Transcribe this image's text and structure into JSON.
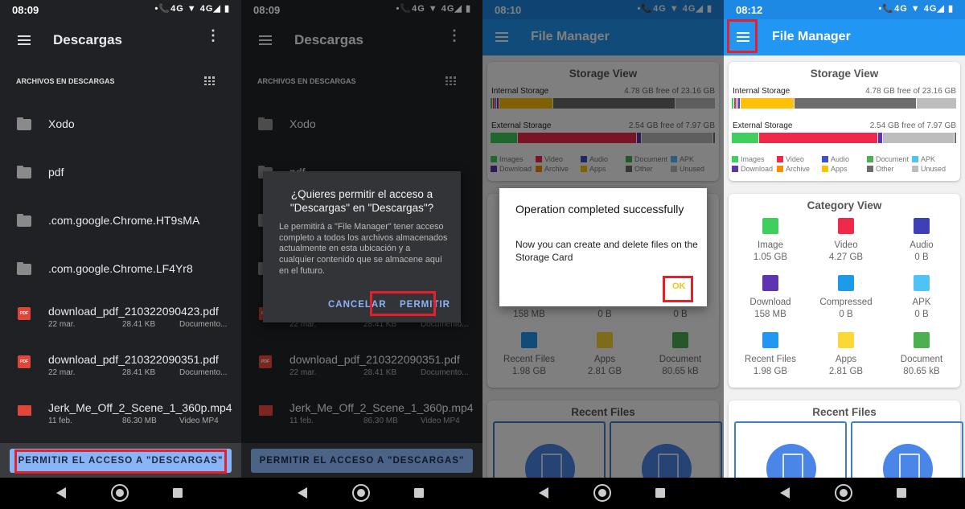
{
  "colors": {
    "highlight": "#e5202b",
    "fm_primary": "#2196f3",
    "dark_bg": "#202124",
    "accent_blue": "#8ab4f8"
  },
  "status_icons": "•📞4G ▼ 4G◢ ▮",
  "panel1": {
    "time": "08:09",
    "title": "Descargas",
    "section": "ARCHIVOS EN DESCARGAS",
    "folders": [
      "Xodo",
      "pdf",
      ".com.google.Chrome.HT9sMA",
      ".com.google.Chrome.LF4Yr8"
    ],
    "files": [
      {
        "icon": "pdf-icon",
        "name": "download_pdf_210322090423.pdf",
        "date": "22 mar.",
        "size": "28.41 KB",
        "type": "Documento..."
      },
      {
        "icon": "pdf-icon",
        "name": "download_pdf_210322090351.pdf",
        "date": "22 mar.",
        "size": "28.41 KB",
        "type": "Documento..."
      },
      {
        "icon": "video-icon",
        "name": "Jerk_Me_Off_2_Scene_1_360p.mp4",
        "date": "11 feb.",
        "size": "86.30 MB",
        "type": "Video MP4"
      }
    ],
    "allow_button": "PERMITIR EL ACCESO A \"DESCARGAS\""
  },
  "panel2": {
    "time": "08:09",
    "dialog": {
      "title": "¿Quieres permitir el acceso a \"Descargas\" en \"Descargas\"?",
      "message": "Le permitirá a \"File Manager\" tener acceso completo a todos los archivos almacenados actualmente en esta ubicación y a cualquier contenido que se almacene aquí en el futuro.",
      "cancel": "CANCELAR",
      "allow": "PERMITIR"
    }
  },
  "panel3": {
    "time": "08:10",
    "dialog": {
      "title": "Operation completed successfully",
      "message": "Now you can create and delete files on the Storage Card",
      "ok": "OK"
    }
  },
  "panel4": {
    "time": "08:12"
  },
  "file_manager": {
    "title": "File Manager",
    "storage": {
      "title": "Storage View",
      "internal": {
        "label": "Internal Storage",
        "value": "4.78 GB free of 23.16 GB",
        "segments_percent": [
          {
            "cat": "Images",
            "pct": 1
          },
          {
            "cat": "Video",
            "pct": 1
          },
          {
            "cat": "Audio",
            "pct": 1
          },
          {
            "cat": "Download",
            "pct": 1
          },
          {
            "cat": "Apps",
            "pct": 24
          },
          {
            "cat": "Other",
            "pct": 54
          },
          {
            "cat": "Unused",
            "pct": 18
          }
        ]
      },
      "external": {
        "label": "External Storage",
        "value": "2.54 GB free of 7.97 GB",
        "segments_percent": [
          {
            "cat": "Images",
            "pct": 12
          },
          {
            "cat": "Video",
            "pct": 53
          },
          {
            "cat": "Download",
            "pct": 2
          },
          {
            "cat": "Unused",
            "pct": 32
          },
          {
            "cat": "Other",
            "pct": 1
          }
        ]
      },
      "legend": [
        {
          "label": "Images",
          "color": "#3ecf5c"
        },
        {
          "label": "Video",
          "color": "#f0284a"
        },
        {
          "label": "Audio",
          "color": "#3f51c8"
        },
        {
          "label": "Document",
          "color": "#4caf50"
        },
        {
          "label": "APK",
          "color": "#4fc3f7"
        },
        {
          "label": "Download",
          "color": "#5e35b1"
        },
        {
          "label": "Archive",
          "color": "#fb8c00"
        },
        {
          "label": "Apps",
          "color": "#ffc107"
        },
        {
          "label": "Other",
          "color": "#6d6d6d"
        },
        {
          "label": "Unused",
          "color": "#bdbdbd"
        }
      ]
    },
    "categories": {
      "title": "Category View",
      "items": [
        {
          "name": "Image",
          "size": "1.05 GB",
          "icon": "image-icon",
          "color": "#3ecf5c"
        },
        {
          "name": "Video",
          "size": "4.27 GB",
          "icon": "video-camera-icon",
          "color": "#f0284a"
        },
        {
          "name": "Audio",
          "size": "0 B",
          "icon": "music-note-icon",
          "color": "#3f3fb8"
        },
        {
          "name": "Download",
          "size": "158 MB",
          "icon": "download-icon",
          "color": "#5e35b1"
        },
        {
          "name": "Compressed",
          "size": "0 B",
          "icon": "zip-icon",
          "color": "#1e9be8"
        },
        {
          "name": "APK",
          "size": "0 B",
          "icon": "android-icon",
          "color": "#4fc3f7"
        },
        {
          "name": "Recent Files",
          "size": "1.98 GB",
          "icon": "history-icon",
          "color": "#2196f3"
        },
        {
          "name": "Apps",
          "size": "2.81 GB",
          "icon": "apps-window-icon",
          "color": "#fdd835"
        },
        {
          "name": "Document",
          "size": "80.65 kB",
          "icon": "document-icon",
          "color": "#4caf50"
        }
      ]
    },
    "recent": {
      "title": "Recent Files"
    }
  }
}
